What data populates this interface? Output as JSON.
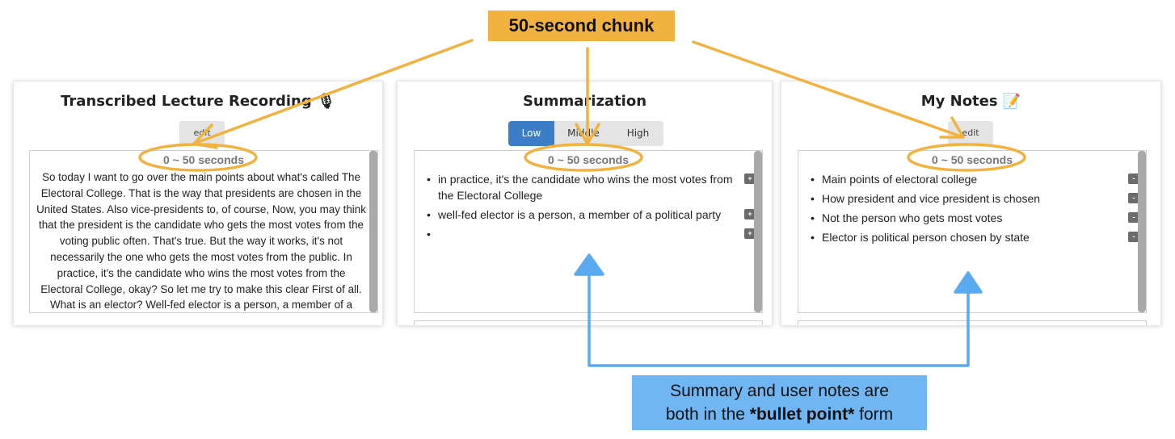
{
  "callouts": {
    "top": "50-second chunk",
    "bottom_line1": "Summary and user notes are",
    "bottom_line2_prefix": "both in the ",
    "bottom_line2_bold": "*bullet point*",
    "bottom_line2_suffix": " form"
  },
  "panels": {
    "transcript": {
      "title": "Transcribed Lecture Recording 🎙",
      "edit_label": "edit",
      "time_range": "0 ~ 50 seconds",
      "text": "So today I want to go over the main points about what's called The Electoral College. That is the way that presidents are chosen in the United States. Also vice-presidents to, of course, Now, you may think that the president is the candidate who gets the most votes from the voting public often. That's true. But the way it works, it's not necessarily the one who gets the most votes from the public. In practice, it's the candidate who wins the most votes from the Electoral College, okay? So let me try to make this clear First of all. What is an elector? Well-fed elector is a person, a member of a political party. Who is Ben Cho?"
    },
    "summary": {
      "title": "Summarization",
      "levels": [
        "Low",
        "Middle",
        "High"
      ],
      "selected_level": "Low",
      "time_range": "0 ~ 50 seconds",
      "bullets": [
        "in practice, it's the candidate who wins the most votes from the Electoral College",
        "well-fed elector is a person, a member of a political party",
        ""
      ],
      "action_symbol": "+"
    },
    "notes": {
      "title": "My Notes 📝",
      "edit_label": "edit",
      "time_range": "0 ~ 50 seconds",
      "bullets": [
        "Main points of electoral college",
        "How president and vice president is chosen",
        "Not the person who gets most votes",
        "Elector is political person chosen by state"
      ],
      "action_symbol": "-"
    }
  },
  "colors": {
    "orange_annotation": "#f2b23f",
    "blue_annotation": "#6fb6f3",
    "active_tab": "#3c7dc8"
  }
}
